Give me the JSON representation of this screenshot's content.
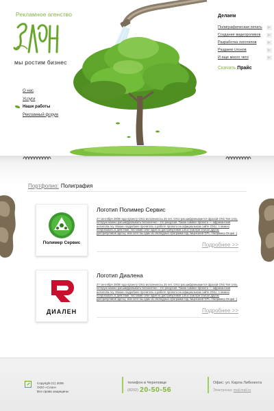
{
  "header": {
    "agency": "Рекламное агенство",
    "motto": "мы ростим бизнес"
  },
  "nav": {
    "items": [
      {
        "label": "О нас"
      },
      {
        "label": "Услуги"
      },
      {
        "label": "Наши работы"
      },
      {
        "label": "Рекламный форум"
      }
    ]
  },
  "doing": {
    "title": "Делаем",
    "items": [
      {
        "label": "Полиграфическая печать"
      },
      {
        "label": "Создание видеороликов"
      },
      {
        "label": "Разработка логотипов"
      },
      {
        "label": "Раздаем слонов"
      },
      {
        "label": "И еще много чего"
      }
    ],
    "download": "Скачать",
    "price": "Прайс"
  },
  "breadcrumb": {
    "section": "Портфолио:",
    "current": "Полиграфия"
  },
  "portfolio": [
    {
      "title": "Логотип Полимер Сервис",
      "logo_text": "Полимер Сервис",
      "description": "27 сентября 2008 года проекту GNU исполнилось 25 лет. GNU расшифровывается фразой GNU Not Unix, которую можно расшифровывать бесконечно - это рекурсия. Также символ проекта — африканская антилопа гну. Можно подробнее прочитать о работе проекта на официальном сайте GNU. А можно попробовать в действии, поставив себе один из дистрибутивов Linux (смотри список других дистрибутивов здесь), или хотя бы один из свободных программ под лицензией GPL. Например Drupal :)",
      "more": "Подробнее >>"
    },
    {
      "title": "Логотип Диалена",
      "logo_text": "ДИАЛЕН",
      "description": "27 сентября 2008 года проекту GNU исполнилось 25 лет. GNU расшифровывается фразой GNU Not Unix, которую можно расшифровывать бесконечно - это рекурсия. Также символ проекта — африканская антилопа гну. Можно подробнее прочитать о работе проекта на официальном сайте GNU. А можно попробовать в действии, поставив себе один из дистрибутивов Linux (смотри список других дистрибутивов здесь), или хотя бы один из свободных программ под лицензией GPL. Например Drupal :)",
      "more": "Подробнее >>"
    }
  ],
  "footer": {
    "copyright": [
      "Copyright (C) 2008",
      "ООО «Слон»",
      "Все права защищены"
    ],
    "phone_label": "телефон в Череповце",
    "phone_code": "(8202)",
    "phone": "20-50-56",
    "address": "Офис: ул. Карла Либкнехта",
    "email_label": "Электронка:",
    "email": "mail.mail.ru"
  },
  "colors": {
    "accent": "#7fb33a",
    "leaf": "#6aa62d",
    "red_logo": "#c8102e"
  }
}
